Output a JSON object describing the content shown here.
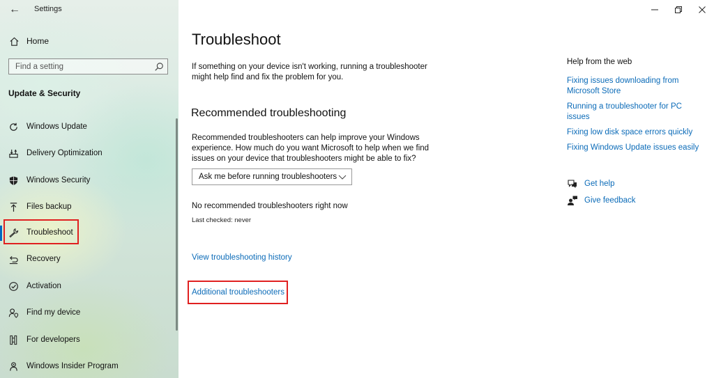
{
  "app": {
    "title": "Settings",
    "back_glyph": "←"
  },
  "sidebar": {
    "home_label": "Home",
    "search": {
      "placeholder": "Find a setting"
    },
    "section_heading": "Update & Security",
    "items": [
      {
        "label": "Windows Update",
        "icon": "refresh-icon"
      },
      {
        "label": "Delivery Optimization",
        "icon": "delivery-optimization-icon"
      },
      {
        "label": "Windows Security",
        "icon": "shield-icon"
      },
      {
        "label": "Files backup",
        "icon": "backup-arrow-icon"
      },
      {
        "label": "Troubleshoot",
        "icon": "wrench-icon",
        "selected": true
      },
      {
        "label": "Recovery",
        "icon": "recovery-icon"
      },
      {
        "label": "Activation",
        "icon": "check-circle-icon"
      },
      {
        "label": "Find my device",
        "icon": "person-location-icon"
      },
      {
        "label": "For developers",
        "icon": "developer-tools-icon"
      },
      {
        "label": "Windows Insider Program",
        "icon": "insider-icon"
      }
    ]
  },
  "main": {
    "title": "Troubleshoot",
    "description": "If something on your device isn't working, running a troubleshooter might help find and fix the problem for you.",
    "recommended": {
      "heading": "Recommended troubleshooting",
      "description": "Recommended troubleshooters can help improve your Windows experience. How much do you want Microsoft to help when we find issues on your device that troubleshooters might be able to fix?",
      "dropdown_value": "Ask me before running troubleshooters",
      "status": "No recommended troubleshooters right now",
      "last_checked": "Last checked: never"
    },
    "history_link": "View troubleshooting history",
    "additional_link": "Additional troubleshooters"
  },
  "help_panel": {
    "heading": "Help from the web",
    "links": [
      "Fixing issues downloading from Microsoft Store",
      "Running a troubleshooter for PC issues",
      "Fixing low disk space errors quickly",
      "Fixing Windows Update issues easily"
    ],
    "get_help": "Get help",
    "give_feedback": "Give feedback"
  },
  "colors": {
    "accent": "#0067c0",
    "link": "#0b6bb8",
    "highlight": "#e02020"
  }
}
